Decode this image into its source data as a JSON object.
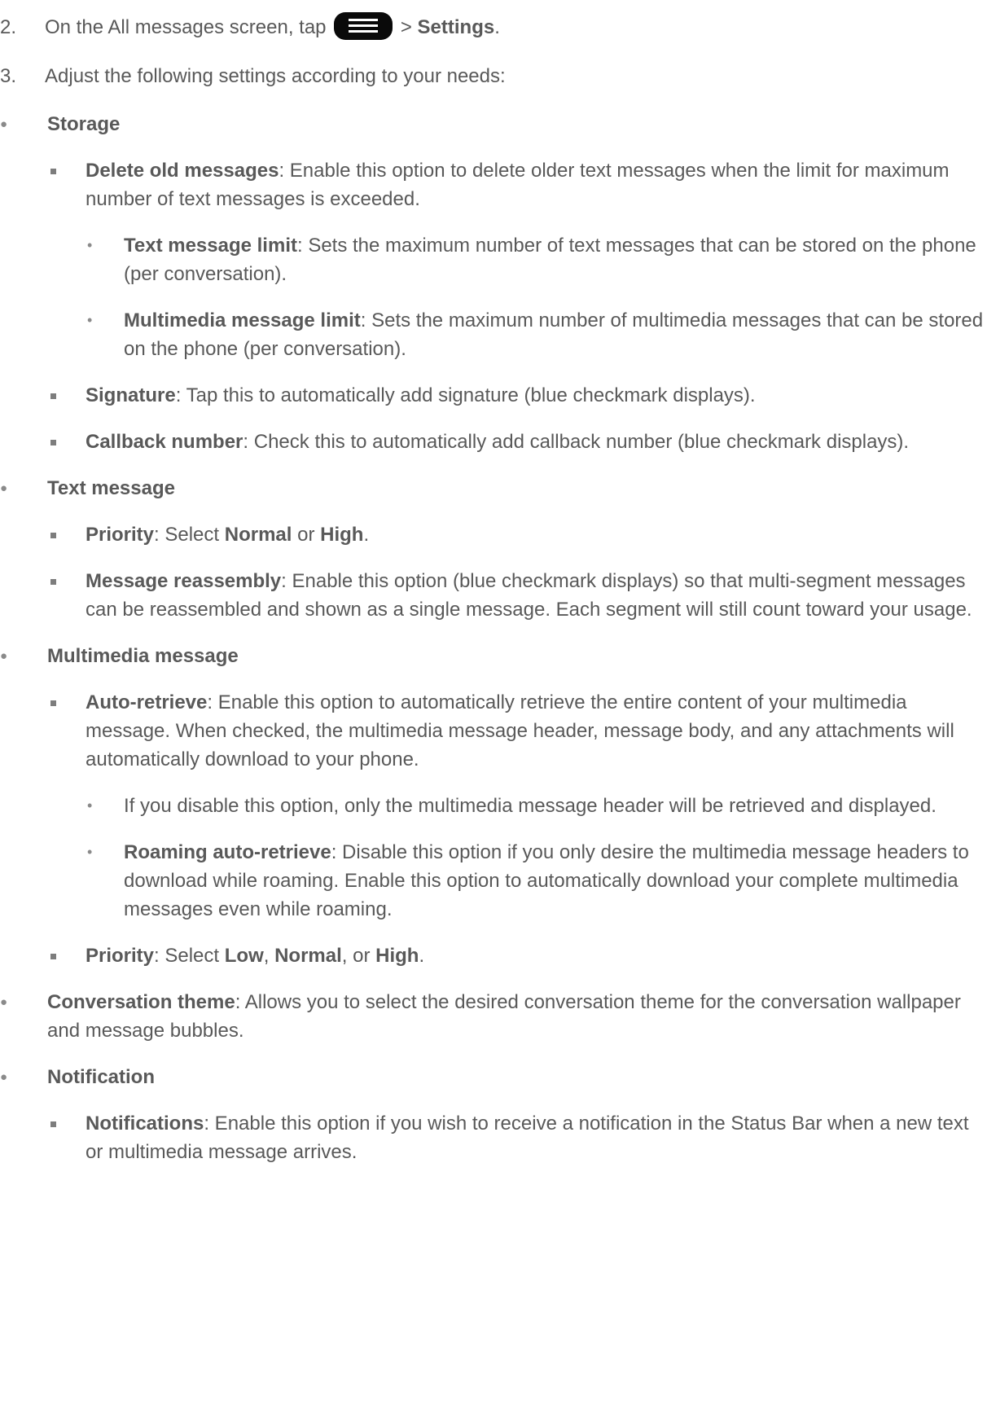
{
  "steps": [
    {
      "num": "2.",
      "pre": "On the All messages screen, tap ",
      "icon": "menu-icon",
      "mid": " > ",
      "bold": "Settings",
      "post": "."
    },
    {
      "num": "3.",
      "text": "Adjust the following settings according to your needs:"
    }
  ],
  "storage": {
    "heading": "Storage",
    "delete_old": {
      "term": "Delete old messages",
      "desc": ": Enable this option to delete older text messages when the limit for maximum number of text messages is exceeded."
    },
    "text_limit": {
      "term": "Text message limit",
      "desc": ": Sets the maximum number of text messages that can be stored on the phone (per conversation)."
    },
    "mm_limit": {
      "term": "Multimedia message limit",
      "desc": ": Sets the maximum number of multimedia messages that can be stored on the phone (per conversation)."
    },
    "signature": {
      "term": "Signature",
      "desc": ": Tap this to automatically add signature (blue checkmark displays)."
    },
    "callback": {
      "term": "Callback number",
      "desc": ": Check this to automatically add callback number (blue checkmark displays)."
    }
  },
  "text_message": {
    "heading": "Text message",
    "priority": {
      "term": "Priority",
      "t1": ": Select ",
      "o1": "Normal",
      "t2": " or ",
      "o2": "High",
      "t3": "."
    },
    "reassembly": {
      "term": "Message reassembly",
      "desc": ": Enable this option (blue checkmark displays) so that multi-segment messages can be reassembled and shown as a single message. Each segment will still count toward your usage."
    }
  },
  "multimedia_message": {
    "heading": "Multimedia message",
    "auto_retrieve": {
      "term": "Auto-retrieve",
      "desc": ": Enable this option to automatically retrieve the entire content of your multimedia message. When checked, the multimedia message header, message body, and any attachments will automatically download to your phone."
    },
    "disable_note": "If you disable this option, only the multimedia message header will be retrieved and displayed.",
    "roaming": {
      "term": "Roaming auto-retrieve",
      "desc": ": Disable this option if you only desire the multimedia message headers to download while roaming. Enable this option to automatically download your complete multimedia messages even while roaming."
    },
    "priority": {
      "term": "Priority",
      "t1": ": Select ",
      "o1": "Low",
      "t2": ", ",
      "o2": "Normal",
      "t3": ", or ",
      "o3": "High",
      "t4": "."
    }
  },
  "conversation_theme": {
    "term": "Conversation theme",
    "desc": ": Allows you to select the desired conversation theme for the conversation wallpaper and message bubbles."
  },
  "notification": {
    "heading": "Notification",
    "notifications": {
      "term": "Notifications",
      "desc": ": Enable this option if you wish to receive a notification in the Status Bar when a new text or multimedia message arrives."
    }
  }
}
